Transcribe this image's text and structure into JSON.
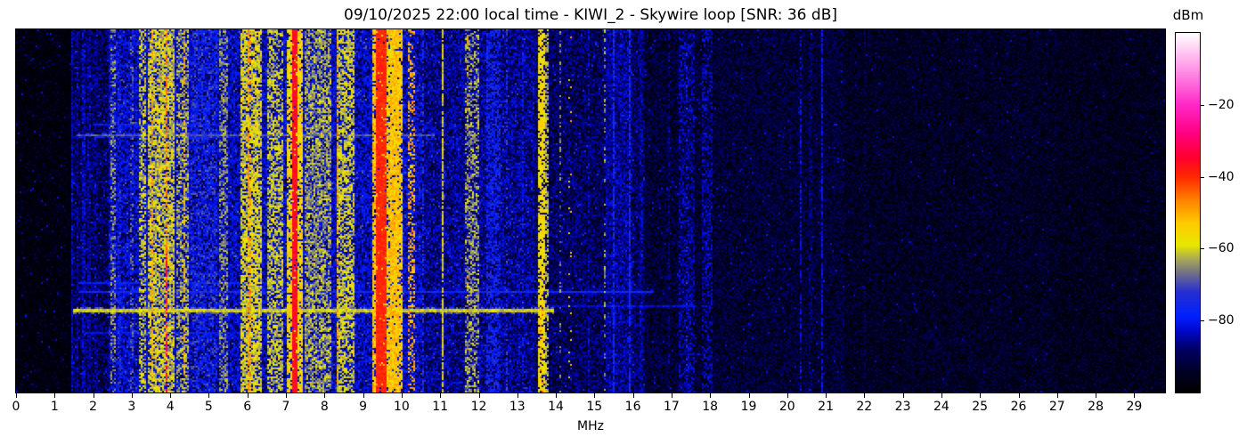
{
  "chart_data": {
    "type": "heatmap",
    "title": "09/10/2025 22:00 local time - KIWI_2 - Skywire loop [SNR: 36 dB]",
    "xlabel": "MHz",
    "x_range": [
      0,
      29.8
    ],
    "x_ticks": [
      0,
      1,
      2,
      3,
      4,
      5,
      6,
      7,
      8,
      9,
      10,
      11,
      12,
      13,
      14,
      15,
      16,
      17,
      18,
      19,
      20,
      21,
      22,
      23,
      24,
      25,
      26,
      27,
      28,
      29
    ],
    "y_ticks": [],
    "colorbar": {
      "label": "dBm",
      "domain": [
        -100,
        0
      ],
      "ticks": [
        -20,
        -40,
        -60,
        -80
      ]
    },
    "colormap_stops": [
      [
        0.0,
        "#000000"
      ],
      [
        0.06,
        "#000028"
      ],
      [
        0.12,
        "#000068"
      ],
      [
        0.17,
        "#0008c8"
      ],
      [
        0.21,
        "#0020ff"
      ],
      [
        0.28,
        "#2830d0"
      ],
      [
        0.33,
        "#6f6f8a"
      ],
      [
        0.37,
        "#a8a858"
      ],
      [
        0.41,
        "#e8e800"
      ],
      [
        0.47,
        "#ffcc00"
      ],
      [
        0.53,
        "#ff8800"
      ],
      [
        0.6,
        "#ff2800"
      ],
      [
        0.655,
        "#ff0030"
      ],
      [
        0.72,
        "#ff0080"
      ],
      [
        0.8,
        "#ff28c8"
      ],
      [
        0.9,
        "#ff96e8"
      ],
      [
        1.0,
        "#ffffff"
      ]
    ],
    "noise_regions": [
      {
        "f0": 0.0,
        "f1": 1.42,
        "base": [
          -100,
          -96
        ],
        "speckle": {
          "p": 0.08,
          "level": -89,
          "fall": 5
        },
        "hot": {
          "p": 0.012,
          "level": -80,
          "fall": 4
        }
      },
      {
        "f0": 1.42,
        "f1": 2.4,
        "base": [
          -97,
          -91
        ],
        "speckle": {
          "p": 0.45,
          "level": -83,
          "fall": 6
        },
        "hot": {
          "p": 0.02,
          "level": -73,
          "fall": 5
        }
      },
      {
        "f0": 2.4,
        "f1": 10.55,
        "base": [
          -94,
          -87
        ],
        "speckle": {
          "p": 0.68,
          "level": -78,
          "fall": 7
        },
        "hot": {
          "p": 0.05,
          "level": -68,
          "fall": 6
        }
      },
      {
        "f0": 10.55,
        "f1": 13.45,
        "base": [
          -95,
          -88
        ],
        "speckle": {
          "p": 0.58,
          "level": -80,
          "fall": 7
        },
        "hot": {
          "p": 0.03,
          "level": -70,
          "fall": 5
        }
      },
      {
        "f0": 13.45,
        "f1": 16.3,
        "base": [
          -97,
          -90
        ],
        "speckle": {
          "p": 0.5,
          "level": -83,
          "fall": 6
        },
        "hot": {
          "p": 0.015,
          "level": -72,
          "fall": 5
        }
      },
      {
        "f0": 16.3,
        "f1": 21.5,
        "base": [
          -99,
          -92
        ],
        "speckle": {
          "p": 0.4,
          "level": -87,
          "fall": 5
        },
        "hot": {
          "p": 0.01,
          "level": -79,
          "fall": 4
        }
      },
      {
        "f0": 21.5,
        "f1": 27.0,
        "base": [
          -100,
          -93
        ],
        "speckle": {
          "p": 0.33,
          "level": -89,
          "fall": 5
        },
        "hot": {
          "p": 0.006,
          "level": -81,
          "fall": 4
        }
      },
      {
        "f0": 27.0,
        "f1": 29.8,
        "base": [
          -100,
          -94
        ],
        "speckle": {
          "p": 0.3,
          "level": -90,
          "fall": 5
        },
        "hot": {
          "p": 0.004,
          "level": -83,
          "fall": 4
        }
      }
    ],
    "signal_bands": [
      {
        "f0": 1.43,
        "f1": 1.49,
        "level": -80,
        "var": 8,
        "d": 0.85
      },
      {
        "f0": 1.55,
        "f1": 1.62,
        "level": -81,
        "var": 8,
        "d": 0.5
      },
      {
        "f0": 1.7,
        "f1": 1.78,
        "level": -79,
        "var": 8,
        "d": 0.7
      },
      {
        "f0": 1.85,
        "f1": 1.92,
        "level": -81,
        "var": 8,
        "d": 0.6
      },
      {
        "f0": 2.05,
        "f1": 2.12,
        "level": -82,
        "var": 8,
        "d": 0.5
      },
      {
        "f0": 2.44,
        "f1": 2.58,
        "level": -60,
        "var": 12,
        "d": 0.45
      },
      {
        "f0": 2.62,
        "f1": 2.72,
        "level": -72,
        "var": 10,
        "d": 0.4
      },
      {
        "f0": 2.95,
        "f1": 3.05,
        "level": -64,
        "var": 10,
        "d": 0.35
      },
      {
        "f0": 3.18,
        "f1": 3.38,
        "level": -55,
        "var": 12,
        "d": 0.55
      },
      {
        "f0": 3.42,
        "f1": 4.12,
        "level": -54,
        "var": 13,
        "d": 0.75
      },
      {
        "f0": 3.53,
        "f1": 3.58,
        "level": -46,
        "var": 7,
        "d": 0.5
      },
      {
        "f0": 3.88,
        "f1": 3.94,
        "level": -42,
        "var": 7,
        "d": 0.55
      },
      {
        "f0": 3.88,
        "f1": 3.93,
        "level": -30,
        "var": 5,
        "d": 0.6,
        "t0": 0.62,
        "t1": 1
      },
      {
        "f0": 4.18,
        "f1": 4.5,
        "level": -58,
        "var": 11,
        "d": 0.55
      },
      {
        "f0": 4.33,
        "f1": 4.38,
        "level": -48,
        "var": 7,
        "d": 0.5
      },
      {
        "f0": 4.55,
        "f1": 5.2,
        "level": -68,
        "var": 12,
        "d": 0.35
      },
      {
        "f0": 5.28,
        "f1": 5.52,
        "level": -60,
        "var": 10,
        "d": 0.5
      },
      {
        "f0": 5.82,
        "f1": 6.38,
        "level": -54,
        "var": 11,
        "d": 0.75
      },
      {
        "f0": 6.02,
        "f1": 6.12,
        "level": -44,
        "var": 8,
        "d": 0.45
      },
      {
        "f0": 6.5,
        "f1": 6.95,
        "level": -56,
        "var": 10,
        "d": 0.6
      },
      {
        "f0": 7.02,
        "f1": 7.42,
        "level": -50,
        "var": 11,
        "d": 0.8
      },
      {
        "f0": 7.18,
        "f1": 7.28,
        "level": -33,
        "var": 6,
        "d": 0.95
      },
      {
        "f0": 7.5,
        "f1": 8.2,
        "level": -58,
        "var": 11,
        "d": 0.65
      },
      {
        "f0": 8.3,
        "f1": 8.78,
        "level": -55,
        "var": 10,
        "d": 0.65
      },
      {
        "f0": 8.32,
        "f1": 8.38,
        "level": -44,
        "var": 8,
        "d": 0.35
      },
      {
        "f0": 9.22,
        "f1": 10.02,
        "level": -48,
        "var": 10,
        "d": 0.8
      },
      {
        "f0": 9.35,
        "f1": 9.62,
        "level": -37,
        "var": 5,
        "d": 0.95
      },
      {
        "f0": 9.7,
        "f1": 9.92,
        "level": -50,
        "var": 10,
        "d": 0.7
      },
      {
        "f0": 10.18,
        "f1": 10.35,
        "level": -45,
        "var": 10,
        "d": 0.4
      },
      {
        "f0": 10.55,
        "f1": 10.6,
        "level": -70,
        "var": 8,
        "d": 0.5
      },
      {
        "f0": 11.05,
        "f1": 11.1,
        "level": -55,
        "var": 8,
        "d": 0.85
      },
      {
        "f0": 11.64,
        "f1": 12.0,
        "level": -58,
        "var": 12,
        "d": 0.5
      },
      {
        "f0": 11.7,
        "f1": 11.74,
        "level": -45,
        "var": 6,
        "d": 0.12
      },
      {
        "f0": 12.18,
        "f1": 12.55,
        "level": -72,
        "var": 10,
        "d": 0.5
      },
      {
        "f0": 12.7,
        "f1": 12.74,
        "level": -68,
        "var": 8,
        "d": 0.3
      },
      {
        "f0": 13.1,
        "f1": 13.16,
        "level": -75,
        "var": 8,
        "d": 0.4
      },
      {
        "f0": 13.56,
        "f1": 13.72,
        "level": -52,
        "var": 8,
        "d": 0.8
      },
      {
        "f0": 13.74,
        "f1": 13.8,
        "level": -58,
        "var": 8,
        "d": 0.6
      },
      {
        "f0": 13.6,
        "f1": 13.66,
        "level": -42,
        "var": 6,
        "d": 0.15,
        "t0": 0.75,
        "t1": 1
      },
      {
        "f0": 14.08,
        "f1": 14.16,
        "level": -62,
        "var": 10,
        "d": 0.25
      },
      {
        "f0": 14.32,
        "f1": 14.4,
        "level": -48,
        "var": 8,
        "d": 0.08
      },
      {
        "f0": 14.82,
        "f1": 14.88,
        "level": -78,
        "var": 8,
        "d": 0.5
      },
      {
        "f0": 15.25,
        "f1": 15.3,
        "level": -60,
        "var": 8,
        "d": 0.3
      },
      {
        "f0": 15.3,
        "f1": 16.0,
        "level": -80,
        "var": 8,
        "d": 0.55
      },
      {
        "f0": 15.48,
        "f1": 15.54,
        "level": -72,
        "var": 6,
        "d": 0.7
      },
      {
        "f0": 15.88,
        "f1": 15.94,
        "level": -72,
        "var": 6,
        "d": 0.7
      },
      {
        "f0": 16.18,
        "f1": 16.24,
        "level": -80,
        "var": 8,
        "d": 0.5
      },
      {
        "f0": 16.9,
        "f1": 16.96,
        "level": -82,
        "var": 8,
        "d": 0.45
      },
      {
        "f0": 17.2,
        "f1": 17.6,
        "level": -80,
        "var": 8,
        "d": 0.5
      },
      {
        "f0": 17.38,
        "f1": 17.44,
        "level": -70,
        "var": 6,
        "d": 0.15
      },
      {
        "f0": 17.78,
        "f1": 18.05,
        "level": -80,
        "var": 8,
        "d": 0.45
      },
      {
        "f0": 20.33,
        "f1": 20.39,
        "level": -78,
        "var": 7,
        "d": 0.55
      },
      {
        "f0": 20.58,
        "f1": 20.63,
        "level": -84,
        "var": 6,
        "d": 0.5
      },
      {
        "f0": 20.88,
        "f1": 20.93,
        "level": -78,
        "var": 6,
        "d": 0.8
      },
      {
        "f0": 21.98,
        "f1": 22.03,
        "level": -86,
        "var": 5,
        "d": 0.4
      }
    ],
    "streaks": [
      {
        "t": 0.262,
        "f0": 2.0,
        "f1": 5.2,
        "level": -76,
        "w": 1
      },
      {
        "t": 0.289,
        "f0": 1.55,
        "f1": 10.8,
        "level": -66,
        "w": 1
      },
      {
        "t": 0.7,
        "f0": 1.6,
        "f1": 7.8,
        "level": -75,
        "w": 1
      },
      {
        "t": 0.725,
        "f0": 1.6,
        "f1": 16.5,
        "level": -73,
        "w": 1
      },
      {
        "t": 0.762,
        "f0": 13.9,
        "f1": 17.6,
        "level": -79,
        "w": 1
      },
      {
        "t": 0.775,
        "f0": 1.5,
        "f1": 13.9,
        "level": -58,
        "w": 2
      },
      {
        "t": 0.838,
        "f0": 1.8,
        "f1": 6.4,
        "level": -77,
        "w": 1
      }
    ],
    "texture": {
      "seed": 1337,
      "cols": 645,
      "rows": 204
    }
  }
}
